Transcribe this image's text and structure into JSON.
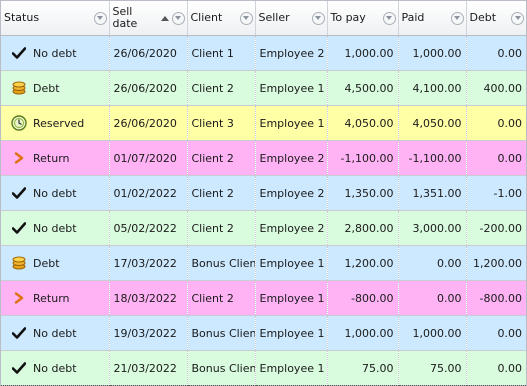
{
  "columns": [
    {
      "label": "Status"
    },
    {
      "label": "Sell\ndate",
      "sort": "ascending"
    },
    {
      "label": "Client"
    },
    {
      "label": "Seller"
    },
    {
      "label": "To pay"
    },
    {
      "label": "Paid"
    },
    {
      "label": "Debt"
    }
  ],
  "status_colors": {
    "No debt": "#cce8ff",
    "Debt": "#cce8ff",
    "Reserved": "#ffffa8",
    "Return": "#ffb6f5",
    "alt": "#d8fadc"
  },
  "rows": [
    {
      "status": "No debt",
      "icon": "check-icon",
      "date": "26/06/2020",
      "client": "Client 1",
      "seller": "Employee 2",
      "to_pay": "1,000.00",
      "paid": "1,000.00",
      "debt": "0.00",
      "bg": "#cde9ff"
    },
    {
      "status": "Debt",
      "icon": "coins-icon",
      "date": "26/06/2020",
      "client": "Client 2",
      "seller": "Employee 1",
      "to_pay": "4,500.00",
      "paid": "4,100.00",
      "debt": "400.00",
      "bg": "#d9fbde"
    },
    {
      "status": "Reserved",
      "icon": "clock-icon",
      "date": "26/06/2020",
      "client": "Client 3",
      "seller": "Employee 1",
      "to_pay": "4,050.00",
      "paid": "4,050.00",
      "debt": "0.00",
      "bg": "#ffffa6"
    },
    {
      "status": "Return",
      "icon": "return-arrow-icon",
      "date": "01/07/2020",
      "client": "Client 2",
      "seller": "Employee 2",
      "to_pay": "-1,100.00",
      "paid": "-1,100.00",
      "debt": "0.00",
      "bg": "#ffb3f5"
    },
    {
      "status": "No debt",
      "icon": "check-icon",
      "date": "01/02/2022",
      "client": "Client 2",
      "seller": "Employee 2",
      "to_pay": "1,350.00",
      "paid": "1,351.00",
      "debt": "-1.00",
      "bg": "#cde9ff"
    },
    {
      "status": "No debt",
      "icon": "check-icon",
      "date": "05/02/2022",
      "client": "Client 2",
      "seller": "Employee 2",
      "to_pay": "2,800.00",
      "paid": "3,000.00",
      "debt": "-200.00",
      "bg": "#d9fbde"
    },
    {
      "status": "Debt",
      "icon": "coins-icon",
      "date": "17/03/2022",
      "client": "Bonus Client",
      "seller": "Employee 1",
      "to_pay": "1,200.00",
      "paid": "0.00",
      "debt": "1,200.00",
      "bg": "#cde9ff"
    },
    {
      "status": "Return",
      "icon": "return-arrow-icon",
      "date": "18/03/2022",
      "client": "Client 2",
      "seller": "Employee 1",
      "to_pay": "-800.00",
      "paid": "0.00",
      "debt": "-800.00",
      "bg": "#ffb3f5"
    },
    {
      "status": "No debt",
      "icon": "check-icon",
      "date": "19/03/2022",
      "client": "Bonus Client",
      "seller": "Employee 1",
      "to_pay": "1,000.00",
      "paid": "1,000.00",
      "debt": "0.00",
      "bg": "#cde9ff"
    },
    {
      "status": "No debt",
      "icon": "check-icon",
      "date": "21/03/2022",
      "client": "Bonus Client",
      "seller": "Employee 1",
      "to_pay": "75.00",
      "paid": "75.00",
      "debt": "0.00",
      "bg": "#d9fbde"
    }
  ]
}
